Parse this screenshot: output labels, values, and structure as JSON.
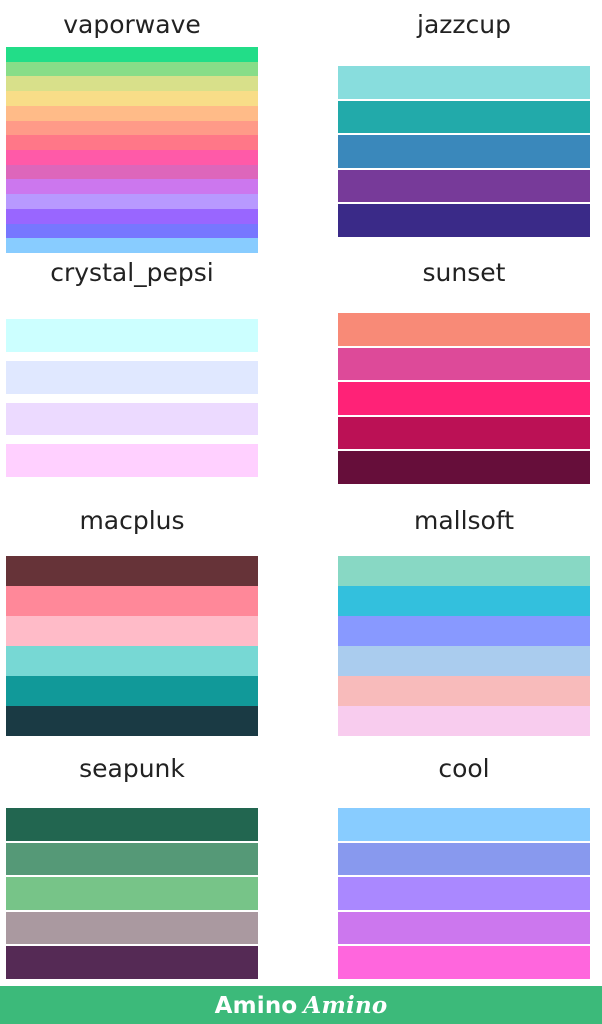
{
  "palettes": [
    {
      "id": "vaporwave",
      "name": "vaporwave",
      "colors": [
        "#22dd88",
        "#88dd88",
        "#d8e08a",
        "#f8dd88",
        "#ffbb88",
        "#ff9a88",
        "#ff7788",
        "#ff5aa8",
        "#dd66bb",
        "#cc77ee",
        "#b899ff",
        "#9966ff",
        "#7777ff",
        "#88ccff"
      ]
    },
    {
      "id": "jazzcup",
      "name": "jazzcup",
      "colors": [
        "#88dddd",
        "#22aaaa",
        "#3a88bb",
        "#773a99",
        "#3a2a88"
      ]
    },
    {
      "id": "crystal_pepsi",
      "name": "crystal_pepsi",
      "colors": [
        "#ccffff",
        "#e0e8ff",
        "#ecdaff",
        "#ffd0ff"
      ]
    },
    {
      "id": "sunset",
      "name": "sunset",
      "colors": [
        "#f88a77",
        "#dd4a99",
        "#ff2277",
        "#bb1155",
        "#660e3a"
      ]
    },
    {
      "id": "macplus",
      "name": "macplus",
      "colors": [
        "#663338",
        "#ff8899",
        "#ffbbc8",
        "#77d8d4",
        "#119999",
        "#1a3a44"
      ]
    },
    {
      "id": "mallsoft",
      "name": "mallsoft",
      "colors": [
        "#88d8c4",
        "#33c0dd",
        "#8899ff",
        "#aaccee",
        "#f8bbbb",
        "#f8ccee"
      ]
    },
    {
      "id": "seapunk",
      "name": "seapunk",
      "colors": [
        "#226650",
        "#559977",
        "#77c488",
        "#aa99a0",
        "#552a55"
      ]
    },
    {
      "id": "cool",
      "name": "cool",
      "colors": [
        "#88ccff",
        "#8899ee",
        "#aa88ff",
        "#cc77ee",
        "#ff66dd"
      ]
    }
  ],
  "footer": {
    "brand": "Amino",
    "brand_script": "Amino",
    "background": "#3cba7a"
  }
}
